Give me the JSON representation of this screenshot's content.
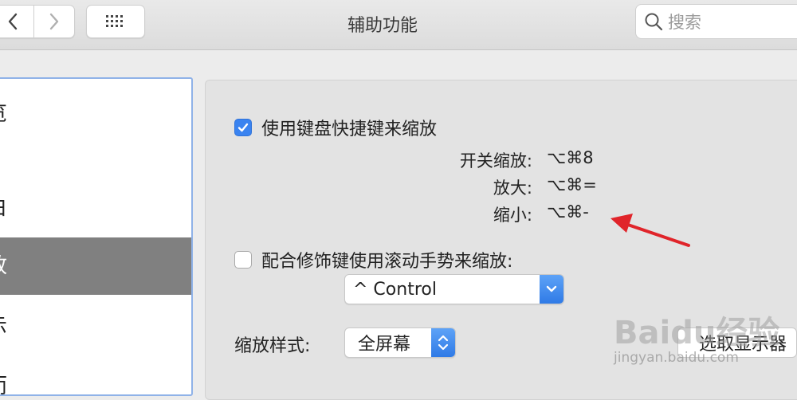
{
  "window": {
    "title": "辅助功能"
  },
  "toolbar": {
    "search_placeholder": "搜索"
  },
  "sidebar": {
    "items": [
      {
        "label": "览",
        "selected": false
      },
      {
        "label": "白",
        "selected": false
      },
      {
        "label": "放",
        "selected": true
      },
      {
        "label": "示",
        "selected": false
      },
      {
        "label": "而",
        "selected": false
      }
    ]
  },
  "zoom": {
    "keyboard_shortcuts": {
      "label": "使用键盘快捷键来缩放",
      "checked": true,
      "toggle_label": "开关缩放:",
      "toggle_keys": "⌥⌘8",
      "zoom_in_label": "放大:",
      "zoom_in_keys": "⌥⌘=",
      "zoom_out_label": "缩小:",
      "zoom_out_keys": "⌥⌘-"
    },
    "scroll_gesture": {
      "label": "配合修饰键使用滚动手势来缩放:",
      "checked": false,
      "modifier_value": "^ Control"
    },
    "zoom_style": {
      "label": "缩放样式:",
      "value": "全屏幕"
    },
    "choose_display_button": "选取显示器"
  },
  "watermark": {
    "text": "Baidu经验",
    "sub": "jingyan.baidu.com"
  },
  "colors": {
    "accent": "#3a83f0",
    "selection": "#808080",
    "arrow": "#e0242a"
  }
}
